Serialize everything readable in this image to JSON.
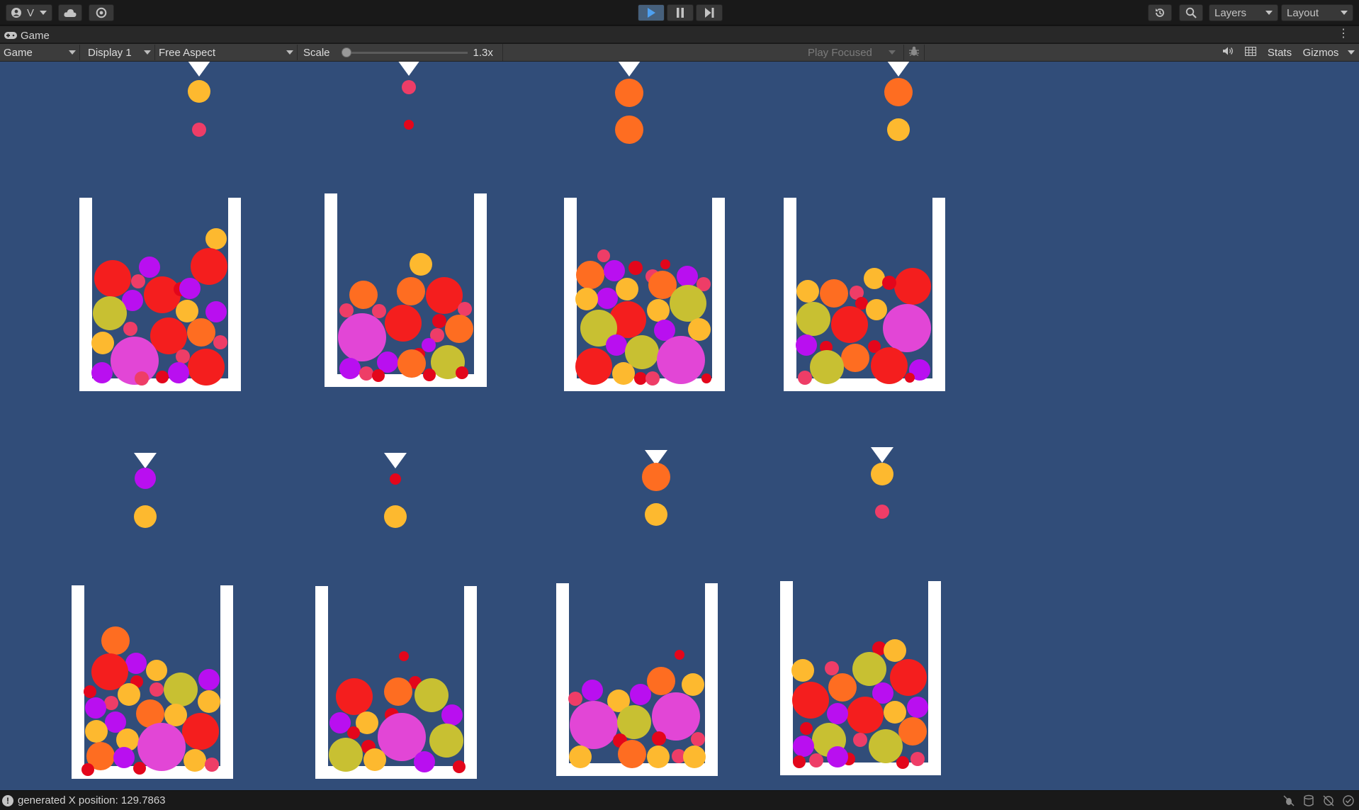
{
  "toolbar": {
    "account_label": "V",
    "layers_label": "Layers",
    "layout_label": "Layout",
    "account_icon": "account-icon",
    "cloud_icon": "cloud-icon",
    "settings_icon": "services-icon",
    "play_icon": "play-icon",
    "pause_icon": "pause-icon",
    "step_icon": "step-icon",
    "history_icon": "history-icon",
    "search_icon": "search-icon"
  },
  "game_tab": {
    "label": "Game",
    "icon": "gamepad-icon"
  },
  "game_controls": {
    "view_mode": "Game",
    "display": "Display 1",
    "aspect": "Free Aspect",
    "scale_label": "Scale",
    "scale_value": "1.3x",
    "scale_fraction": 0.0,
    "play_mode": "Play Focused",
    "stats_label": "Stats",
    "gizmos_label": "Gizmos"
  },
  "scene": {
    "background_color": "#314d79",
    "container_color": "#ffffff",
    "ball_colors": {
      "red": "#f41e1e",
      "orange": "#fe6d21",
      "yellow": "#fdb92f",
      "olive": "#c8c032",
      "magenta": "#e246d6",
      "purple": "#b90ff0",
      "pink": "#ee3d67",
      "darkred": "#e3061b"
    }
  },
  "status_bar": {
    "message": "generated X position: 129.7863",
    "warning_icon": "warning-icon"
  }
}
